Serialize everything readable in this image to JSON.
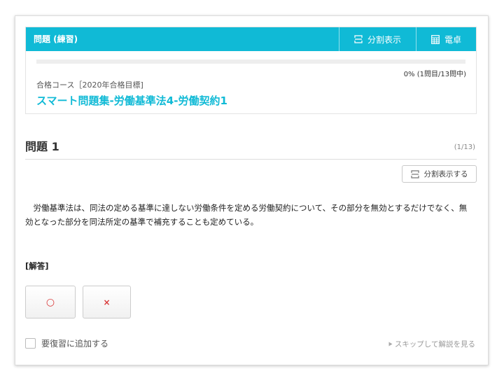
{
  "header": {
    "title": "問題 (練習)",
    "split_label": "分割表示",
    "calc_label": "電卓"
  },
  "progress": {
    "percent": 0,
    "text": "0% (1問目/13問中)"
  },
  "course": {
    "label": "合格コース［2020年合格目標]",
    "title": "スマート問題集-労働基準法4-労働契約1"
  },
  "question": {
    "heading": "問題 1",
    "counter": "(1/13)",
    "split_button": "分割表示する",
    "text": "労働基準法は、同法の定める基準に達しない労働条件を定める労働契約について、その部分を無効とするだけでなく、無効となった部分を同法所定の基準で補充することも定めている。"
  },
  "answer": {
    "label": "[解答]",
    "options": [
      "○",
      "×"
    ]
  },
  "footer": {
    "review_label": "要復習に追加する",
    "skip_label": "スキップして解説を見る"
  },
  "colors": {
    "accent": "#10bad6",
    "answer_mark": "#d93a3a"
  }
}
